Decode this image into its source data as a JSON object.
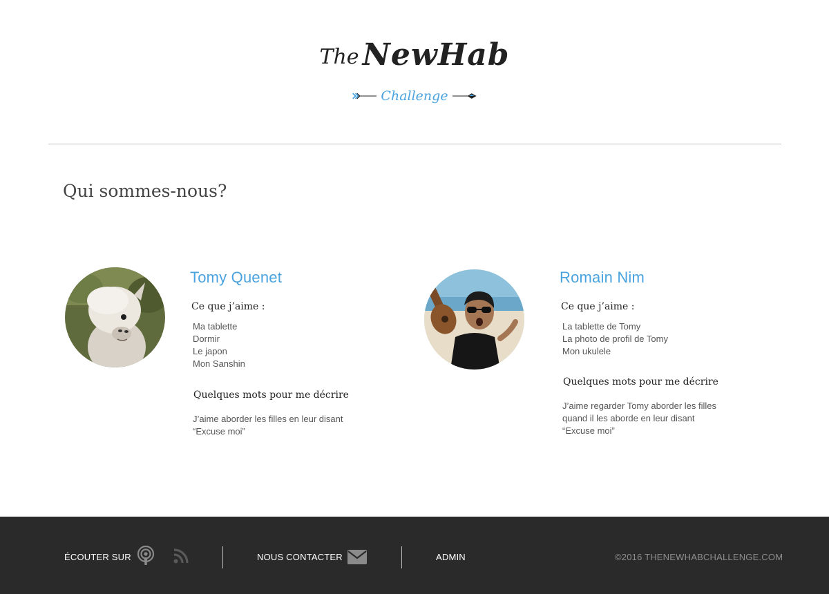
{
  "header": {
    "logo_the": "The",
    "logo_newhab": "NewHab",
    "logo_sub": "Challenge"
  },
  "main": {
    "title": "Qui sommes-nous?",
    "profiles": [
      {
        "name": "Tomy Quenet",
        "likes_heading": "Ce que j’aime :",
        "likes": [
          "Ma tablette",
          "Dormir",
          "Le japon",
          "Mon Sanshin"
        ],
        "words_heading": "Quelques mots pour me décrire",
        "words": "J’aime aborder les filles en leur disant\n“Excuse moi”"
      },
      {
        "name": "Romain Nim",
        "likes_heading": "Ce que j’aime :",
        "likes": [
          "La tablette de Tomy",
          "La photo de profil de Tomy",
          "Mon ukulele"
        ],
        "words_heading": "Quelques mots pour me décrire",
        "words": "J’aime regarder Tomy aborder les filles\nquand il les aborde en leur disant\n“Excuse moi”"
      }
    ]
  },
  "footer": {
    "listen_label": "ÉCOUTER SUR",
    "contact_label": "NOUS CONTACTER",
    "admin_label": "ADMIN",
    "copyright": "©2016 THENEWHABCHALLENGE.COM",
    "icons": [
      "podcast-icon",
      "rss-icon",
      "envelope-icon"
    ]
  },
  "colors": {
    "accent": "#4aa3df",
    "footer_bg": "#2a2a2a",
    "footer_text": "#ffffff",
    "footer_muted": "#8e8e8e"
  }
}
